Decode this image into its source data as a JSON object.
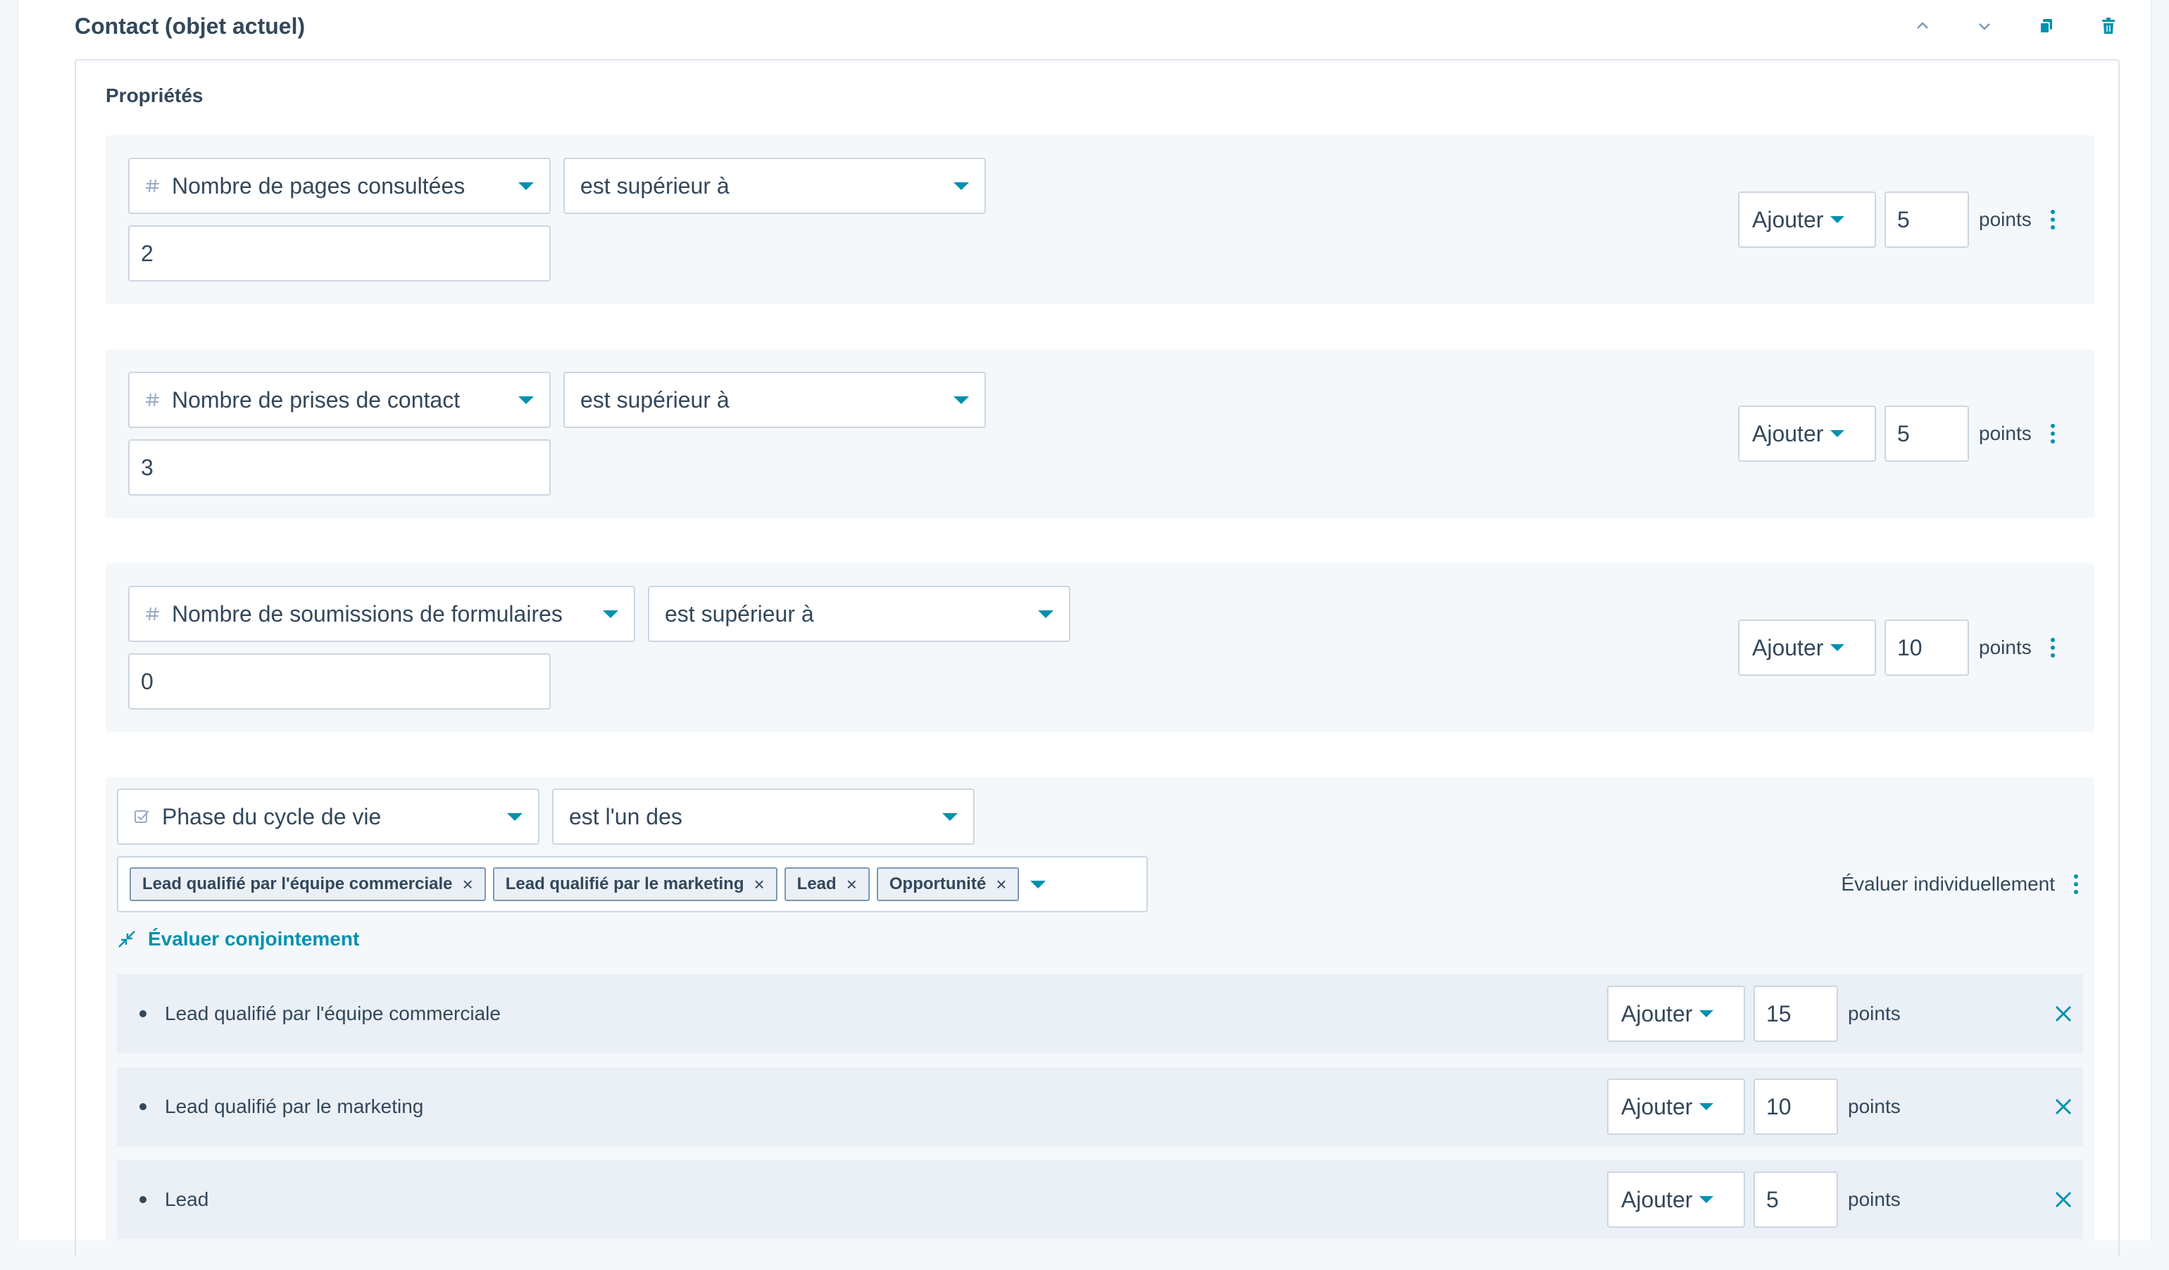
{
  "group": {
    "title": "Contact (objet actuel)",
    "section_label": "Propriétés"
  },
  "rules": [
    {
      "property": "Nombre de pages consultées",
      "operator": "est supérieur à",
      "value": "2",
      "action": "Ajouter",
      "points": "5",
      "points_label": "points"
    },
    {
      "property": "Nombre de prises de contact",
      "operator": "est supérieur à",
      "value": "3",
      "action": "Ajouter",
      "points": "5",
      "points_label": "points"
    },
    {
      "property": "Nombre de soumissions de formulaires",
      "operator": "est supérieur à",
      "value": "0",
      "action": "Ajouter",
      "points": "10",
      "points_label": "points"
    }
  ],
  "lifecycle": {
    "property": "Phase du cycle de vie",
    "operator": "est l'un des",
    "tags": [
      "Lead qualifié par l'équipe commerciale",
      "Lead qualifié par le marketing",
      "Lead",
      "Opportunité"
    ],
    "evaluate_individually": "Évaluer individuellement",
    "evaluate_jointly": "Évaluer conjointement",
    "items": [
      {
        "label": "Lead qualifié par l'équipe commerciale",
        "action": "Ajouter",
        "points": "15",
        "points_label": "points"
      },
      {
        "label": "Lead qualifié par le marketing",
        "action": "Ajouter",
        "points": "10",
        "points_label": "points"
      },
      {
        "label": "Lead",
        "action": "Ajouter",
        "points": "5",
        "points_label": "points"
      }
    ]
  },
  "icons": {
    "number_property": "hash-icon",
    "enum_property": "checkbox-list-icon",
    "move_up": "chevron-up-icon",
    "move_down": "chevron-down-icon",
    "clone": "copy-icon",
    "delete": "trash-icon",
    "evaluate_jointly": "collapse-arrows-icon",
    "more": "more-vertical-icon",
    "remove": "close-icon"
  },
  "colors": {
    "accent": "#0091ae",
    "text": "#33475b",
    "border": "#cbd6e2",
    "panel": "#f5f8fa",
    "subrow": "#eaf0f6"
  }
}
